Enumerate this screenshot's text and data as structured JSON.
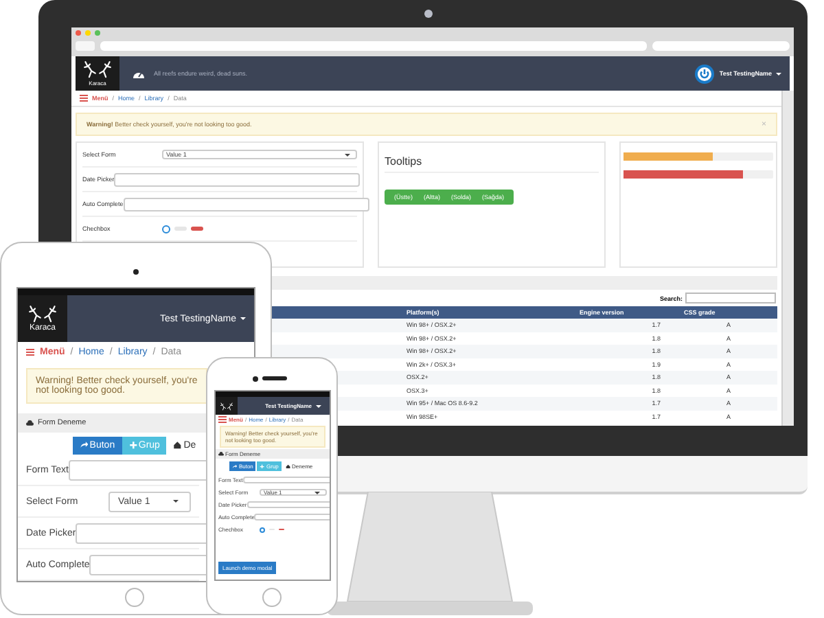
{
  "monitor": {
    "navbar": {
      "brand": "Karaca",
      "tagline": "All reefs endure weird, dead suns.",
      "user": "Test TestingName"
    },
    "breadcrumb": {
      "menu": "Menü",
      "separator": "/",
      "items": [
        {
          "label": "Home",
          "current": false
        },
        {
          "label": "Library",
          "current": false
        },
        {
          "label": "Data",
          "current": true
        }
      ]
    },
    "alert": {
      "text": "**Warning!** Better check yourself, you're not looking too good.",
      "close": "×"
    },
    "form": {
      "fields": [
        {
          "kind": "select",
          "label": "Select Form",
          "value": "Value 1"
        },
        {
          "kind": "text",
          "label": "Date Picker"
        },
        {
          "kind": "text",
          "label": "Auto Complete"
        },
        {
          "kind": "checkbox",
          "label": "Chechbox",
          "checked": true
        }
      ]
    },
    "tooltips": {
      "title": "Tooltips",
      "buttons": [
        "(Üstte)",
        "(Altta)",
        "(Solda)",
        "(Sağda)"
      ]
    },
    "progress": [
      {
        "color": "#f0ad4e",
        "level": 0.6
      },
      {
        "color": "#d9534f",
        "level": 0.8
      }
    ],
    "table": {
      "search_label": "Search:",
      "columns": [
        "Platform(s)",
        "Engine version",
        "CSS grade"
      ],
      "rows": [
        [
          "Win 98+ / OSX.2+",
          "1.7",
          "A"
        ],
        [
          "Win 98+ / OSX.2+",
          "1.8",
          "A"
        ],
        [
          "Win 98+ / OSX.2+",
          "1.8",
          "A"
        ],
        [
          "Win 2k+ / OSX.3+",
          "1.9",
          "A"
        ],
        [
          "OSX.2+",
          "1.8",
          "A"
        ],
        [
          "OSX.3+",
          "1.8",
          "A"
        ],
        [
          "Win 95+ / Mac OS 8.6-9.2",
          "1.7",
          "A"
        ],
        [
          "Win 98SE+",
          "1.7",
          "A"
        ]
      ]
    }
  },
  "tablet": {
    "navbar": {
      "brand": "Karaca",
      "user": "Test TestingName"
    },
    "breadcrumb": {
      "menu": "Menü",
      "separator": "/",
      "items": [
        {
          "label": "Home",
          "current": false
        },
        {
          "label": "Library",
          "current": false
        },
        {
          "label": "Data",
          "current": true
        }
      ]
    },
    "alert": "Warning! Better check yourself, you're not looking too good.",
    "panel_title": "Form Deneme",
    "tabs": [
      {
        "label": "Buton",
        "kind": "primary"
      },
      {
        "label": "Grup",
        "kind": "info"
      },
      {
        "label": "De",
        "kind": "plain"
      }
    ],
    "fields": [
      {
        "kind": "text",
        "label": "Form Text"
      },
      {
        "kind": "select",
        "label": "Select Form",
        "value": "Value 1"
      },
      {
        "kind": "text",
        "label": "Date Picker"
      },
      {
        "kind": "text",
        "label": "Auto Complete"
      }
    ]
  },
  "phone": {
    "navbar": {
      "user": "Test TestingName"
    },
    "breadcrumb": {
      "menu": "Menü",
      "separator": "/",
      "items": [
        {
          "label": "Home",
          "current": false
        },
        {
          "label": "Library",
          "current": false
        },
        {
          "label": "Data",
          "current": true
        }
      ]
    },
    "alert": "Warning! Better check yourself, you're not looking too good.",
    "panel_title": "Form Deneme",
    "tabs": [
      {
        "label": "Buton",
        "kind": "primary"
      },
      {
        "label": "Grup",
        "kind": "info"
      },
      {
        "label": "Deneme",
        "kind": "plain"
      }
    ],
    "fields": [
      {
        "kind": "text",
        "label": "Form Text"
      },
      {
        "kind": "select",
        "label": "Select Form",
        "value": "Value 1"
      },
      {
        "kind": "text",
        "label": "Date Picker"
      },
      {
        "kind": "text",
        "label": "Auto Complete"
      },
      {
        "kind": "checkbox",
        "label": "Chechbox",
        "checked": true
      }
    ],
    "button": "Launch demo modal"
  }
}
